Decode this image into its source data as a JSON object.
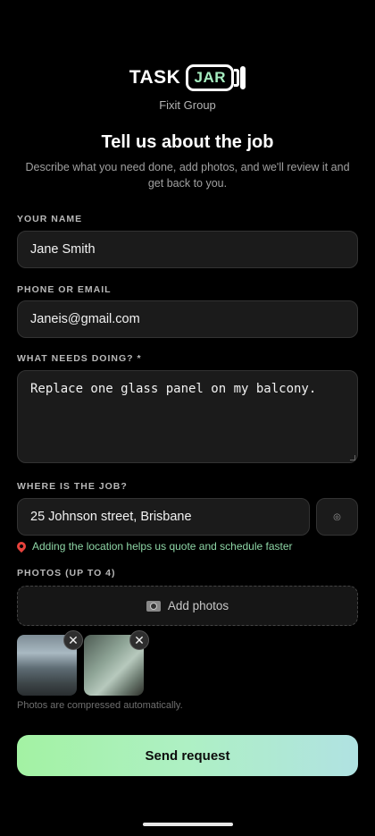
{
  "brand": {
    "word1": "TASK",
    "word2": "JAR",
    "company": "Fixit Group"
  },
  "header": {
    "title": "Tell us about the job",
    "subtitle": "Describe what you need done, add photos, and we'll review it and get back to you."
  },
  "form": {
    "name": {
      "label": "YOUR NAME",
      "value": "Jane Smith"
    },
    "contact": {
      "label": "PHONE OR EMAIL",
      "value": "Janeis@gmail.com"
    },
    "job": {
      "label": "WHAT NEEDS DOING? *",
      "value": "Replace one glass panel on my balcony."
    },
    "location": {
      "label": "WHERE IS THE JOB?",
      "value": "25 Johnson street, Brisbane",
      "button_icon": "◎",
      "hint": "Adding the location helps us quote and schedule faster"
    },
    "photos": {
      "label": "PHOTOS (UP TO 4)",
      "add_label": "Add photos",
      "note": "Photos are compressed automatically.",
      "remove_glyph": "✕"
    }
  },
  "submit": {
    "label": "Send request"
  },
  "colors": {
    "accent": "#a6eec0",
    "hint": "#8ed6a6",
    "button_start": "#a3f2a3",
    "button_end": "#b0e2e2"
  }
}
